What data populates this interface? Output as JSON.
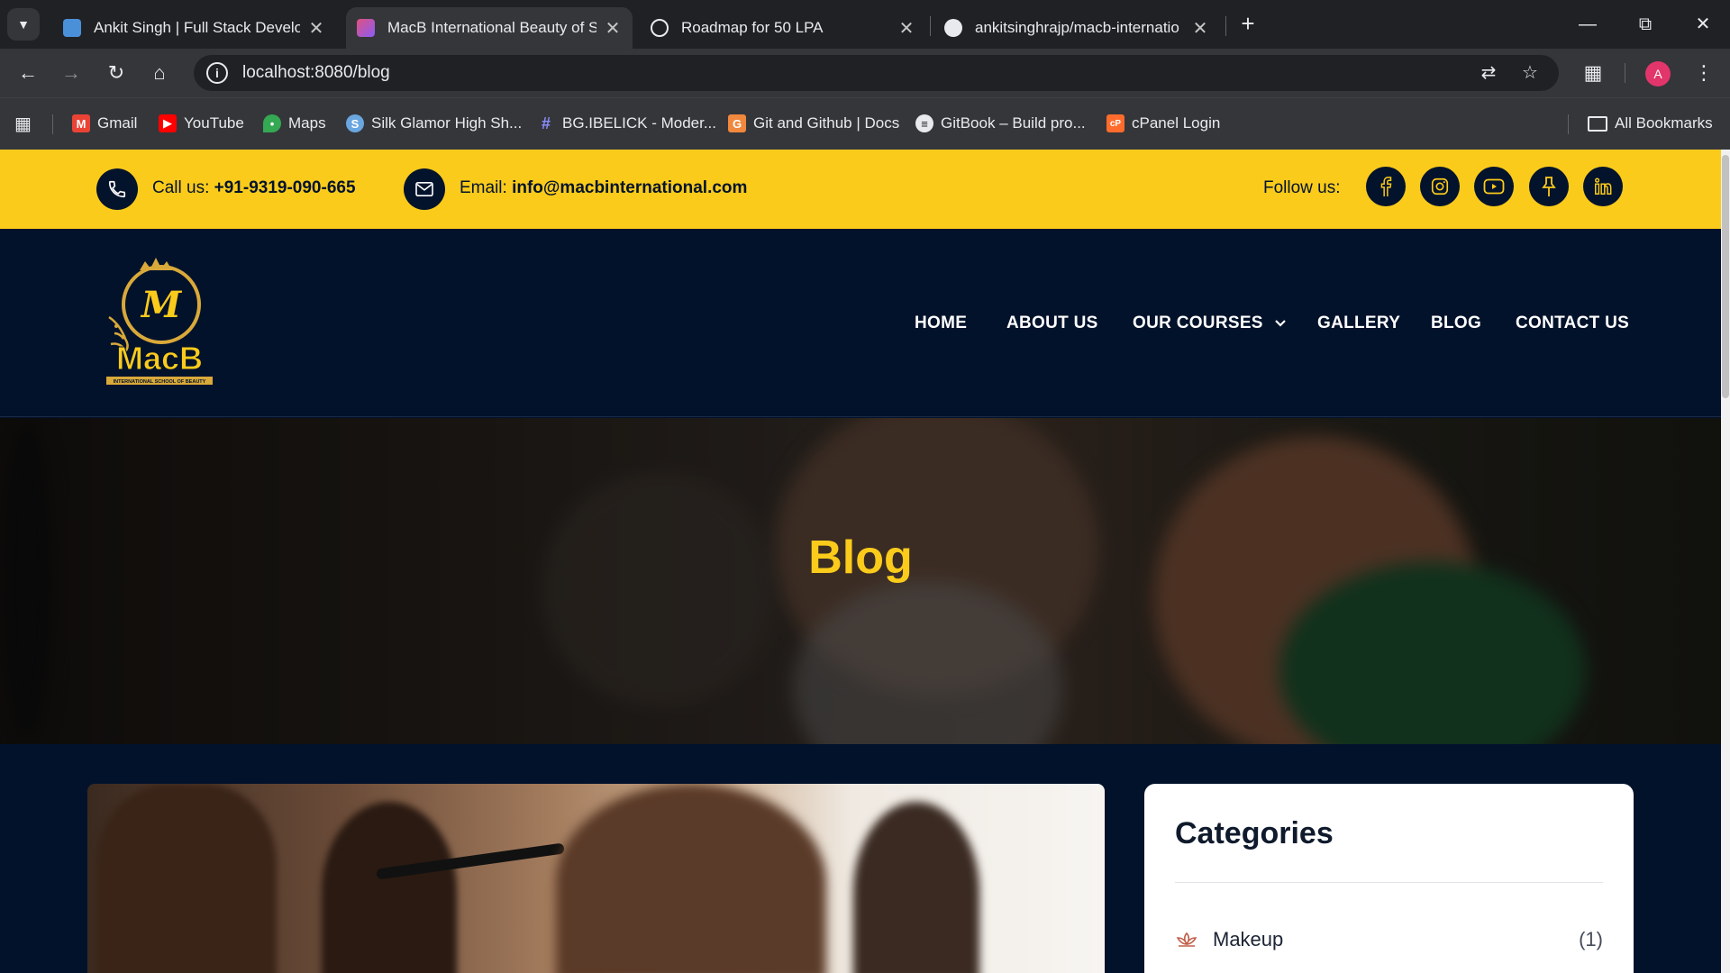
{
  "browser": {
    "tabs": [
      {
        "title": "Ankit Singh | Full Stack Develop",
        "active": false,
        "favicon_color": "#4a90d9"
      },
      {
        "title": "MacB International Beauty of Sc",
        "active": true,
        "favicon_color": "#e0517f"
      },
      {
        "title": "Roadmap for 50 LPA",
        "active": false,
        "favicon_color": "#e8eaed"
      },
      {
        "title": "ankitsinghrajp/macb-internatio",
        "active": false,
        "favicon_color": "#e8eaed"
      }
    ],
    "url": "localhost:8080/blog",
    "profile_initial": "A",
    "bookmarks": [
      {
        "label": "Gmail",
        "icon": "gmail-icon",
        "color": "#ea4335"
      },
      {
        "label": "YouTube",
        "icon": "youtube-icon",
        "color": "#ff0000"
      },
      {
        "label": "Maps",
        "icon": "maps-icon",
        "color": "#34a853"
      },
      {
        "label": "Silk Glamor High Sh...",
        "icon": "silk-icon",
        "color": "#6aa6e0"
      },
      {
        "label": "BG.IBELICK - Moder...",
        "icon": "grid-icon",
        "color": "#8a8fff"
      },
      {
        "label": "Git and Github | Docs",
        "icon": "git-icon",
        "color": "#f0883e"
      },
      {
        "label": "GitBook – Build pro...",
        "icon": "gitbook-icon",
        "color": "#e8eaed"
      },
      {
        "label": "cPanel Login",
        "icon": "cpanel-icon",
        "color": "#ff6c2c"
      }
    ],
    "all_bookmarks": "All Bookmarks"
  },
  "topbar": {
    "call_label": "Call us:",
    "call_value": "+91-9319-090-665",
    "email_label": "Email:",
    "email_value": "info@macbinternational.com",
    "follow_label": "Follow us:",
    "socials": [
      "facebook-icon",
      "instagram-icon",
      "youtube-icon",
      "pinterest-icon",
      "linkedin-icon"
    ]
  },
  "header": {
    "logo_text": "MacB",
    "logo_sub": "INTERNATIONAL SCHOOL OF BEAUTY",
    "logo_letter": "M",
    "nav": [
      "HOME",
      "ABOUT US",
      "OUR COURSES",
      "GALLERY",
      "BLOG",
      "CONTACT US"
    ]
  },
  "hero": {
    "title": "Blog"
  },
  "sidebar": {
    "heading": "Categories",
    "categories": [
      {
        "label": "Makeup",
        "count": "(1)"
      }
    ]
  },
  "colors": {
    "accent": "#fbcb1b",
    "navy": "#02122b"
  }
}
